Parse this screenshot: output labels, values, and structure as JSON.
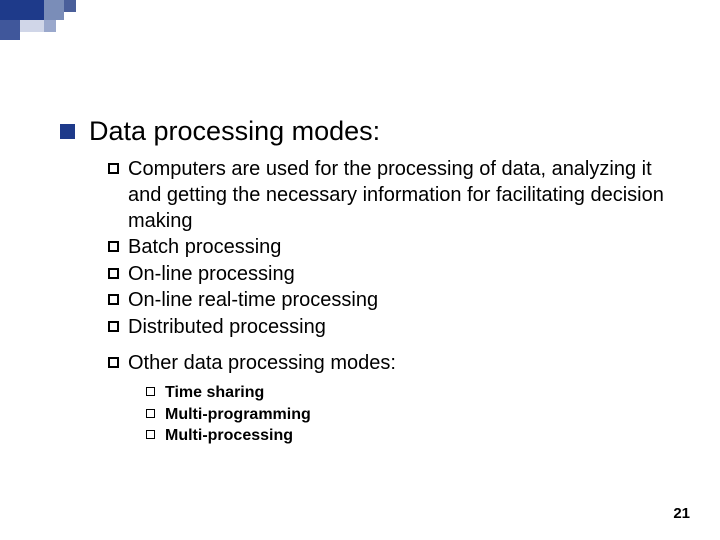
{
  "heading": "Data processing modes:",
  "items": [
    "Computers are used for the processing of data, analyzing it and getting the necessary information for facilitating decision making",
    "Batch processing",
    "On-line processing",
    "On-line real-time processing",
    "Distributed processing"
  ],
  "other_label": "Other data processing modes:",
  "other_items": [
    "Time sharing",
    "Multi-programming",
    "Multi-processing"
  ],
  "page_number": "21"
}
